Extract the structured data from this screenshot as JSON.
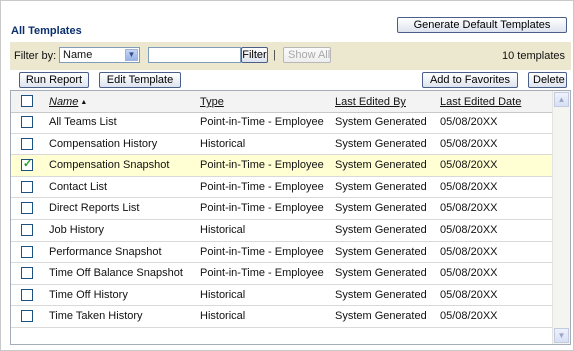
{
  "panel": {
    "title": "All Templates"
  },
  "toolbar": {
    "generate_label": "Generate Default Templates",
    "run_report_label": "Run Report",
    "edit_template_label": "Edit Template",
    "add_favorites_label": "Add to Favorites",
    "delete_label": "Delete"
  },
  "filter": {
    "label": "Filter by:",
    "field_selected": "Name",
    "text_value": "",
    "filter_button": "Filter",
    "separator": "|",
    "show_all_button": "Show All",
    "count_text": "10 templates"
  },
  "table": {
    "columns": [
      "Name",
      "Type",
      "Last Edited By",
      "Last Edited Date"
    ],
    "rows": [
      {
        "name": "All Teams List",
        "type": "Point-in-Time - Employee",
        "edited_by": "System Generated",
        "date": "05/08/20XX",
        "checked": false
      },
      {
        "name": "Compensation History",
        "type": "Historical",
        "edited_by": "System Generated",
        "date": "05/08/20XX",
        "checked": false
      },
      {
        "name": "Compensation Snapshot",
        "type": "Point-in-Time - Employee",
        "edited_by": "System Generated",
        "date": "05/08/20XX",
        "checked": true
      },
      {
        "name": "Contact List",
        "type": "Point-in-Time - Employee",
        "edited_by": "System Generated",
        "date": "05/08/20XX",
        "checked": false
      },
      {
        "name": "Direct Reports List",
        "type": "Point-in-Time - Employee",
        "edited_by": "System Generated",
        "date": "05/08/20XX",
        "checked": false
      },
      {
        "name": "Job History",
        "type": "Historical",
        "edited_by": "System Generated",
        "date": "05/08/20XX",
        "checked": false
      },
      {
        "name": "Performance Snapshot",
        "type": "Point-in-Time - Employee",
        "edited_by": "System Generated",
        "date": "05/08/20XX",
        "checked": false
      },
      {
        "name": "Time Off Balance Snapshot",
        "type": "Point-in-Time - Employee",
        "edited_by": "System Generated",
        "date": "05/08/20XX",
        "checked": false
      },
      {
        "name": "Time Off History",
        "type": "Historical",
        "edited_by": "System Generated",
        "date": "05/08/20XX",
        "checked": false
      },
      {
        "name": "Time Taken History",
        "type": "Historical",
        "edited_by": "System Generated",
        "date": "05/08/20XX",
        "checked": false
      }
    ]
  },
  "icons": {
    "sort": "sort-ascending-icon",
    "dropdown": "chevron-down-icon",
    "scroll_up": "scroll-up-icon",
    "scroll_down": "scroll-down-icon"
  },
  "colors": {
    "filter_bar_bg": "#ece7cf",
    "selected_row_bg": "#ffffd3",
    "title_color": "#0a2f6b"
  }
}
